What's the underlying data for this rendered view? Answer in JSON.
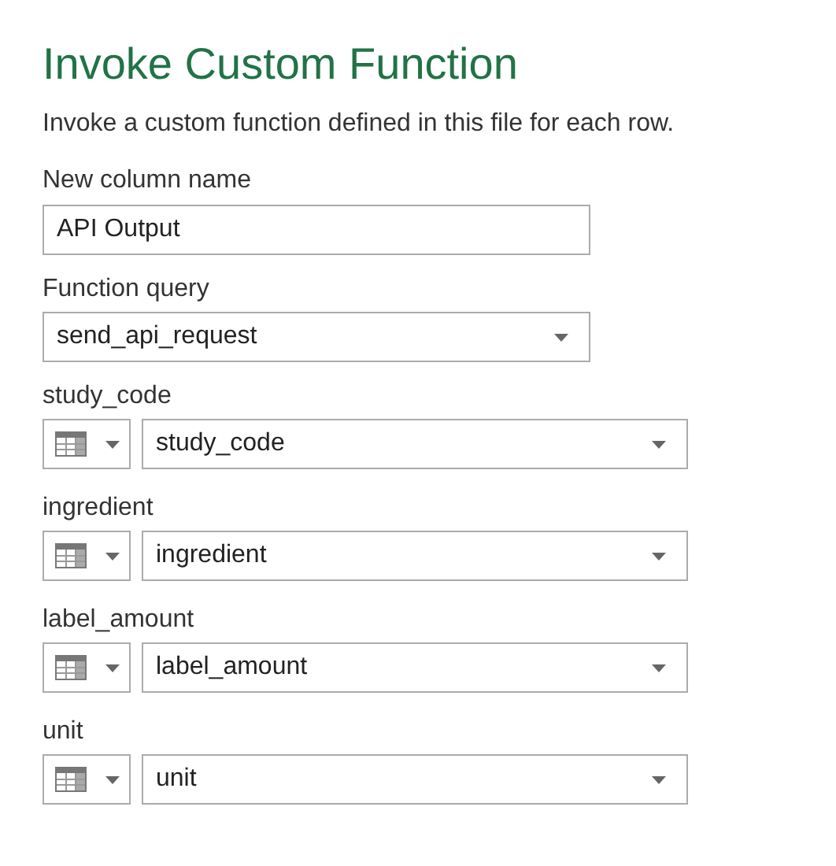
{
  "title": "Invoke Custom Function",
  "description": "Invoke a custom function defined in this file for each row.",
  "new_column": {
    "label": "New column name",
    "value": "API Output"
  },
  "function_query": {
    "label": "Function query",
    "value": "send_api_request"
  },
  "parameters": [
    {
      "label": "study_code",
      "value": "study_code"
    },
    {
      "label": "ingredient",
      "value": "ingredient"
    },
    {
      "label": "label_amount",
      "value": "label_amount"
    },
    {
      "label": "unit",
      "value": "unit"
    }
  ]
}
